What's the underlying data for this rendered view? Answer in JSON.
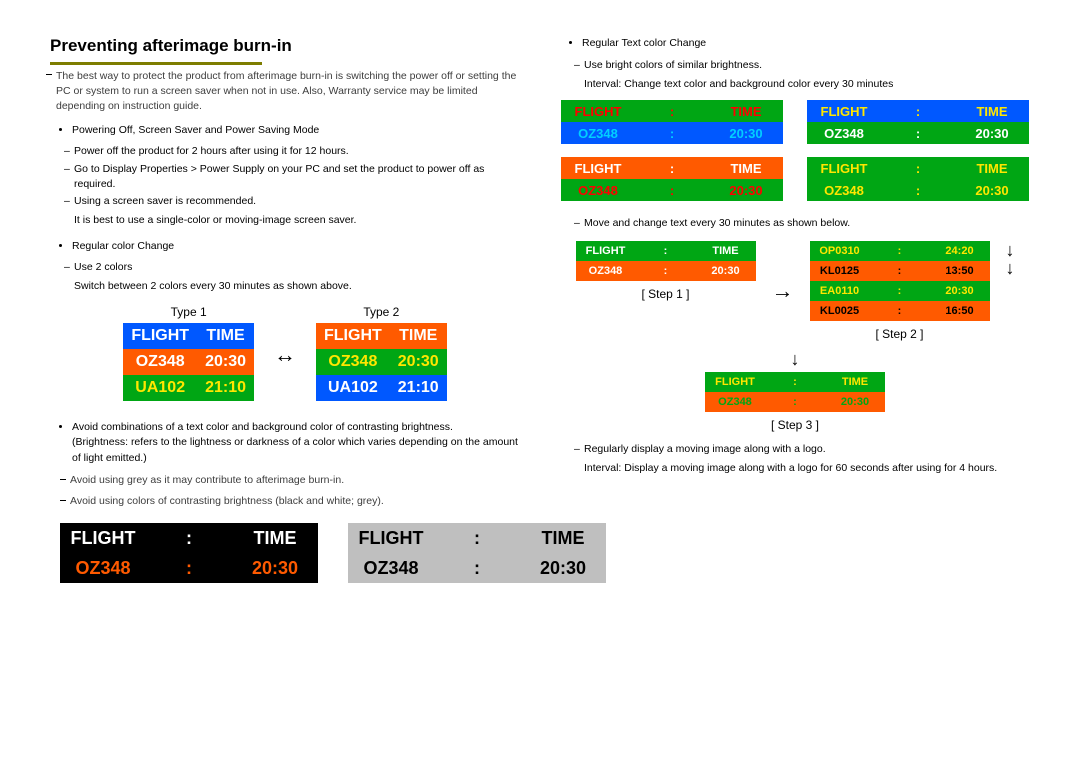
{
  "title": "Preventing afterimage burn-in",
  "intro": "The best way to protect the product from afterimage burn-in is switching the power off or setting the PC or system to run a screen saver when not in use. Also, Warranty service may be limited depending on instruction guide.",
  "b1": "Powering Off, Screen Saver and Power Saving Mode",
  "b1a": "Power off the product for 2 hours after using it for 12 hours.",
  "b1b": "Go to Display Properties > Power Supply on your PC and set the product to power off as required.",
  "b1c": "Using a screen saver is recommended.",
  "b1c2": "It is best to use a single-color or moving-image screen saver.",
  "b2": "Regular color Change",
  "b2a": "Use 2 colors",
  "b2b": "Switch between 2 colors every 30 minutes as shown above.",
  "type1": "Type 1",
  "type2": "Type 2",
  "hdrF": "FLIGHT",
  "hdrT": "TIME",
  "r1c1": "OZ348",
  "r1c2": "20:30",
  "r2c1": "UA102",
  "r2c2": "21:10",
  "avoid1": "Avoid combinations of a text color and background color of contrasting brightness.",
  "avoid1b": "(Brightness: refers to the lightness or darkness of a color which varies depending on the amount of light emitted.)",
  "note1": "Avoid using grey as it may contribute to afterimage burn-in.",
  "note2": "Avoid using colors of contrasting brightness (black and white; grey).",
  "right_b1": "Regular Text color Change",
  "right_b1a": "Use bright colors of similar brightness.",
  "right_b1b": "Interval: Change text color and background color every 30 minutes",
  "right_m1": "Move and change text every 30 minutes as shown below.",
  "step1": "[ Step 1 ]",
  "step2": "[ Step 2 ]",
  "step3": "[ Step 3 ]",
  "s2r1c1": "OP0310",
  "s2r1c2": "24:20",
  "s2r2c1": "KL0125",
  "s2r2c2": "13:50",
  "s2r3c1": "EA0110",
  "s2r3c2": "20:30",
  "s2r4c1": "KL0025",
  "s2r4c2": "16:50",
  "right_b2a": "Regularly display a moving image along with a logo.",
  "right_b2b": "Interval: Display a moving image along with a logo for 60 seconds after using for 4 hours.",
  "colonsep": ":"
}
